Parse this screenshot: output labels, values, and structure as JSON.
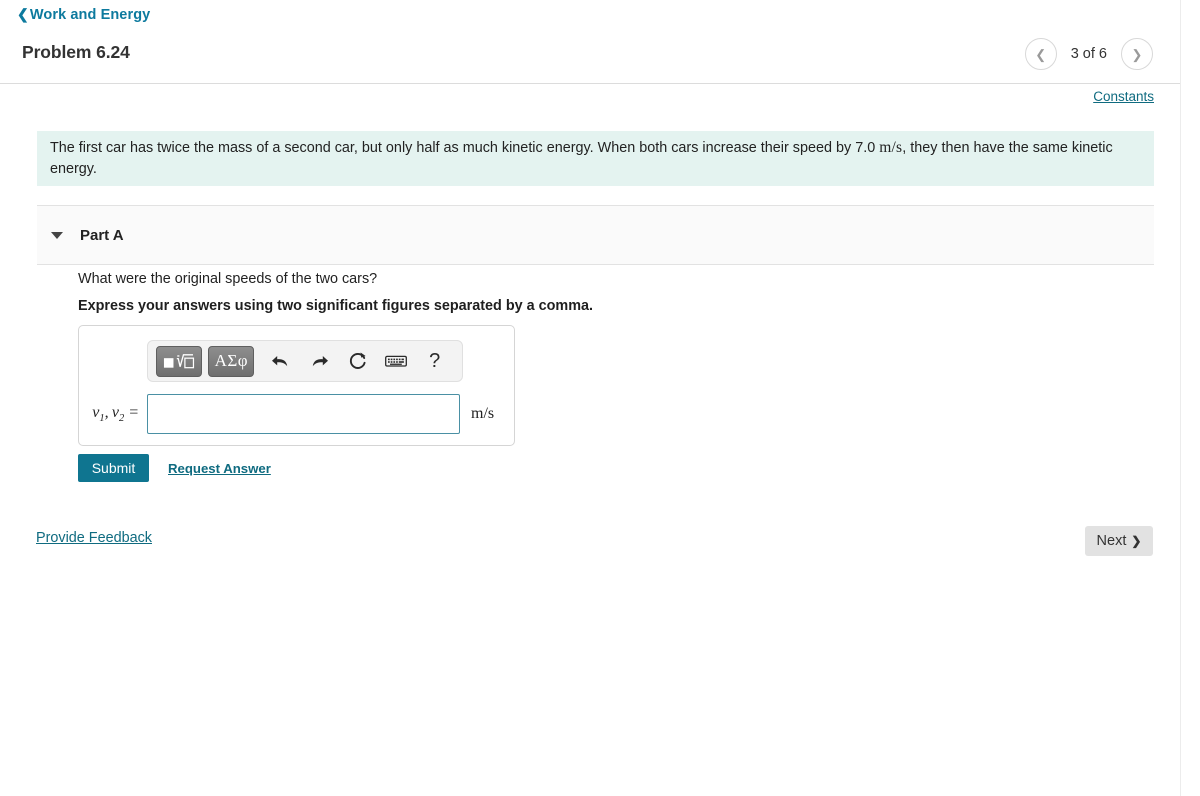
{
  "breadcrumb": {
    "back_icon": "chevron-left-icon",
    "label": "Work and Energy"
  },
  "header": {
    "title": "Problem 6.24",
    "pager": {
      "prev_icon": "chevron-left-icon",
      "next_icon": "chevron-right-icon",
      "label": "3 of 6",
      "current": 3,
      "total": 6
    }
  },
  "constants": {
    "label": "Constants"
  },
  "statement": {
    "part1": "The first car has twice the mass of a second car, but only half as much kinetic energy. When both cars increase their speed by 7.0",
    "unit": "m/s",
    "part2": ", they then have the same kinetic energy.",
    "background_color": "#e4f3f0"
  },
  "part": {
    "caret_icon": "caret-down-icon",
    "label": "Part A",
    "question": "What were the original speeds of the two cars?",
    "instruction": "Express your answers using two significant figures separated by a comma."
  },
  "math_toolbar": {
    "buttons": [
      {
        "name": "template-radical-button",
        "label": "■√□",
        "kind": "template"
      },
      {
        "name": "greek-symbols-button",
        "label": "ΑΣφ",
        "kind": "greek"
      }
    ],
    "icons": [
      {
        "name": "undo-icon",
        "title": "undo"
      },
      {
        "name": "redo-icon",
        "title": "redo"
      },
      {
        "name": "reset-icon",
        "title": "reset"
      },
      {
        "name": "keyboard-icon",
        "title": "keyboard"
      },
      {
        "name": "help-icon",
        "label": "?",
        "title": "help"
      }
    ]
  },
  "answer": {
    "variable_label": "v1, v2 =",
    "var_base_1": "v",
    "var_sub_1": "1",
    "var_base_2": "v",
    "var_sub_2": "2",
    "equals": "=",
    "value": "",
    "placeholder": "",
    "unit": "m/s",
    "border_color": "#4a90a4"
  },
  "actions": {
    "submit_label": "Submit",
    "submit_color": "#0f7590",
    "request_answer_label": "Request Answer",
    "link_color": "#0f6b80"
  },
  "footer": {
    "provide_feedback_label": "Provide Feedback",
    "next_label": "Next",
    "next_icon": "chevron-right-icon"
  }
}
